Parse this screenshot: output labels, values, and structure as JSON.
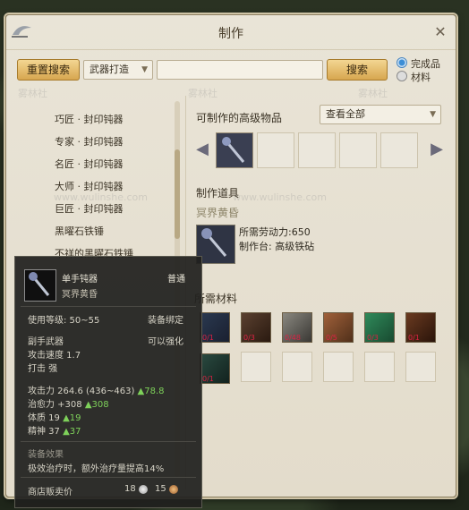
{
  "window": {
    "title": "制作",
    "reset_button": "重置搜索",
    "category_select": "武器打造",
    "search_value": "",
    "search_button": "搜索",
    "radio_finished": "完成品",
    "radio_materials": "材料"
  },
  "left_list": [
    "巧匠 · 封印钝器",
    "专家 · 封印钝器",
    "名匠 · 封印钝器",
    "大师 · 封印钝器",
    "巨匠 · 封印钝器",
    "黑曜石铁锤",
    "不祥的黑曜石铁锤"
  ],
  "right": {
    "advanced_items_title": "可制作的高级物品",
    "filter_select": "查看全部",
    "tool_title": "制作道具",
    "item_name": "冥界黄昏",
    "labor_text": "所需劳动力:650",
    "station_text": "制作台: 高级铁砧",
    "materials_title": "所需材料",
    "materials_counts": [
      "0/1",
      "0/3",
      "0/48",
      "0/5",
      "0/3",
      "0/1",
      "0/1"
    ]
  },
  "tooltip": {
    "item_type": "单手钝器",
    "grade": "普通",
    "item_name": "冥界黄昏",
    "level_req": "使用等级: 50~55",
    "bind": "装备绑定",
    "slot": "副手武器",
    "can_enhance": "可以强化",
    "attack_speed": "攻击速度 1.7",
    "strike": "打击 强",
    "attack_power": "攻击力 264.6 (436~463)",
    "attack_power_up": "▲78.8",
    "heal_power": "治愈力 +308",
    "heal_power_up": "▲308",
    "stamina": "体质 19",
    "stamina_up": "▲19",
    "spirit": "精神 37",
    "spirit_up": "▲37",
    "effect_title": "装备效果",
    "effect_text": "极效治疗时，额外治疗量提高14%",
    "shop_price_label": "商店贩卖价",
    "price_silver": "18",
    "price_copper": "15"
  },
  "watermarks": [
    "雾林社",
    "www.wulinshe.com"
  ],
  "colors": {
    "accent": "#d7a64f",
    "radio_on": "#3d8ed6",
    "stat_up": "#7ed15a",
    "enhance": "#ef9b3c"
  }
}
